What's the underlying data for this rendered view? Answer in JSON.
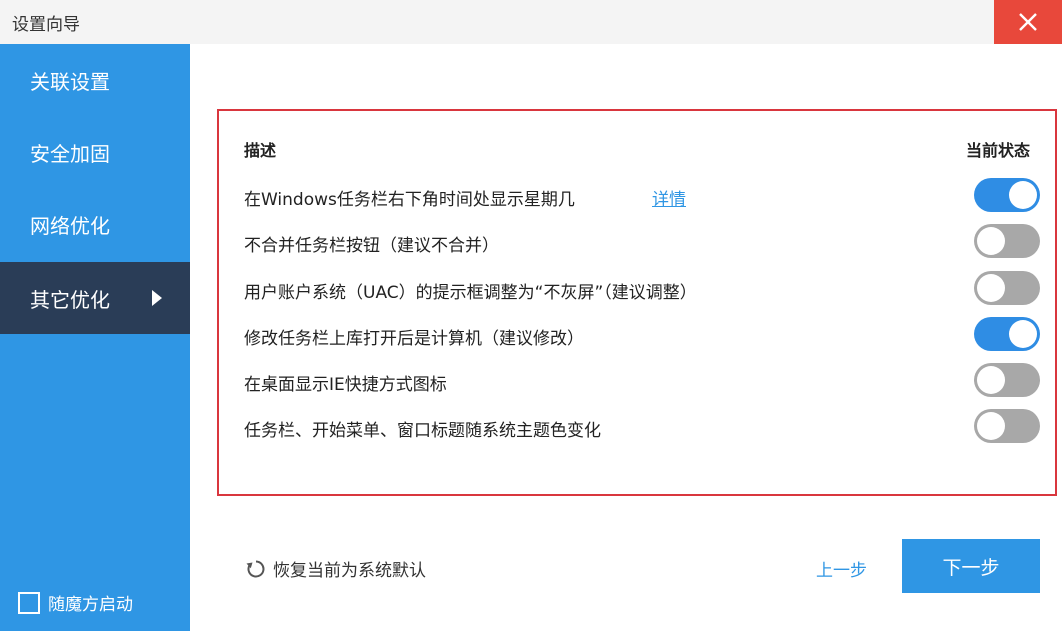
{
  "window": {
    "title": "设置向导",
    "close_icon": "close-icon",
    "close_color": "#e8483b"
  },
  "sidebar": {
    "background": "#2f96e4",
    "active_background": "#2a3d57",
    "items": [
      {
        "label": "关联设置",
        "active": false
      },
      {
        "label": "安全加固",
        "active": false
      },
      {
        "label": "网络优化",
        "active": false
      },
      {
        "label": "其它优化",
        "active": true
      }
    ],
    "autostart_label": "随魔方启动",
    "autostart_checked": false
  },
  "table": {
    "header_desc": "描述",
    "header_status": "当前状态",
    "details_link": "详情",
    "rows": [
      {
        "label": "在Windows任务栏右下角时间处显示星期几",
        "on": true
      },
      {
        "label": "不合并任务栏按钮（建议不合并）",
        "on": false
      },
      {
        "label": "用户账户系统（UAC）的提示框调整为“不灰屏”（建议调整）",
        "on": false
      },
      {
        "label": "修改任务栏上库打开后是计算机（建议修改）",
        "on": true
      },
      {
        "label": "在桌面显示IE快捷方式图标",
        "on": false
      },
      {
        "label": "任务栏、开始菜单、窗口标题随系统主题色变化",
        "on": false
      }
    ]
  },
  "footer": {
    "restore_label": "恢复当前为系统默认",
    "restore_icon": "refresh-icon",
    "prev_label": "上一步",
    "next_label": "下一步"
  }
}
